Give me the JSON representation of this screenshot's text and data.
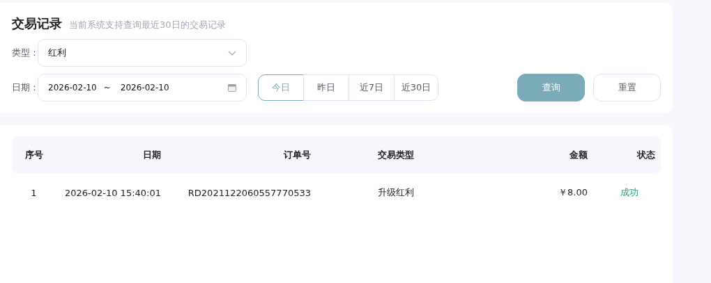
{
  "header": {
    "title": "交易记录",
    "subtitle": "当前系统支持查询最近30日的交易记录"
  },
  "filters": {
    "type": {
      "label": "类型：",
      "value": "红利"
    },
    "date": {
      "label": "日期：",
      "start": "2026-02-10",
      "separator": "~",
      "end": "2026-02-10"
    },
    "quick_ranges": [
      {
        "label": "今日",
        "selected": true
      },
      {
        "label": "昨日",
        "selected": false
      },
      {
        "label": "近7日",
        "selected": false
      },
      {
        "label": "近30日",
        "selected": false
      }
    ],
    "buttons": [
      {
        "label": "查询",
        "kind": "primary"
      },
      {
        "label": "重置",
        "kind": "secondary"
      }
    ]
  },
  "table": {
    "columns": [
      "序号",
      "日期",
      "订单号",
      "交易类型",
      "金额",
      "状态"
    ],
    "rows": [
      {
        "cells": [
          "1",
          "2026-02-10 15:40:01",
          "RD2021122060557770533",
          "升级红利",
          "￥8.00"
        ],
        "status": {
          "text": "成功",
          "kind": "success"
        }
      }
    ]
  }
}
